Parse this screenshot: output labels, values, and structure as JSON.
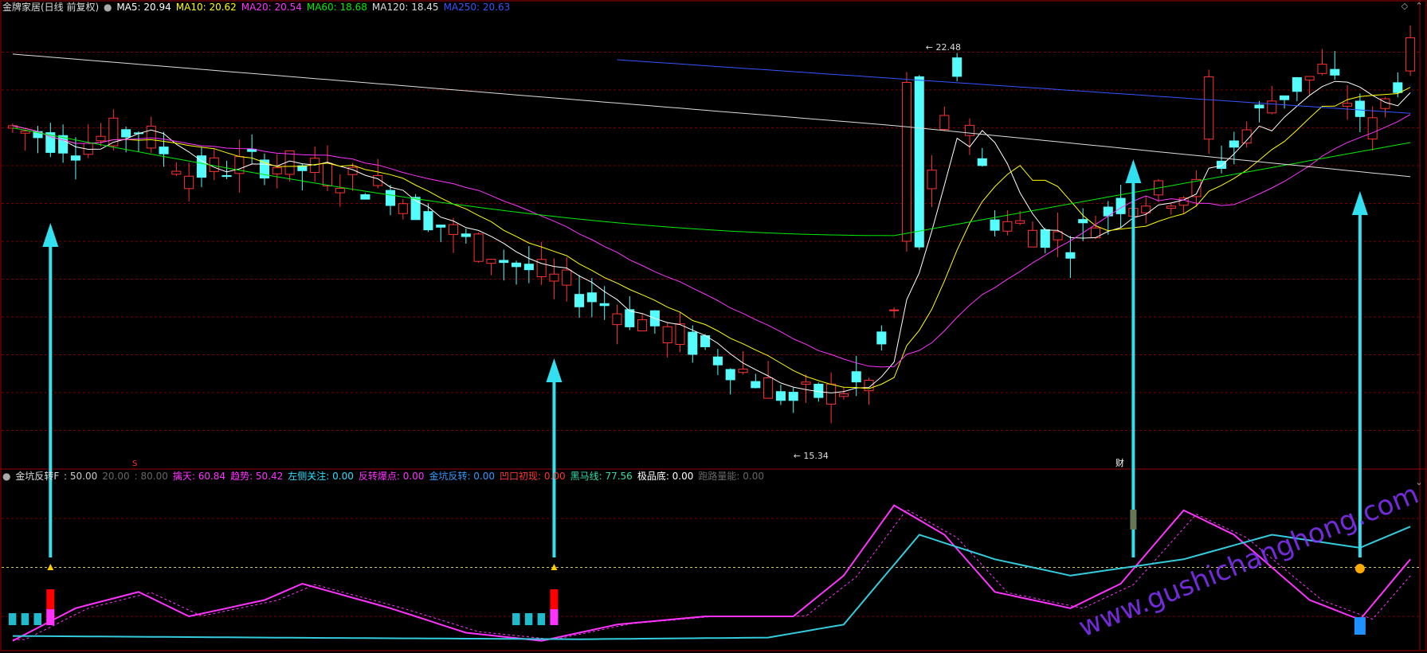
{
  "header": {
    "title": "金牌家居(日线 前复权)",
    "items": [
      {
        "label": "MA5: 20.94",
        "color": "#ffffff"
      },
      {
        "label": "MA10: 20.62",
        "color": "#ffff00"
      },
      {
        "label": "MA20: 20.54",
        "color": "#ff33ff"
      },
      {
        "label": "MA60: 18.68",
        "color": "#00ee00"
      },
      {
        "label": "MA120: 18.45",
        "color": "#dddddd"
      },
      {
        "label": "MA250: 20.63",
        "color": "#3355ff"
      }
    ]
  },
  "indicator_header": {
    "title": "金坑反转F",
    "items": [
      {
        "label": ": 50.00",
        "color": "#cccccc"
      },
      {
        "label": "20.00",
        "color": "#666666"
      },
      {
        "label": ": 80.00",
        "color": "#666666"
      },
      {
        "label": "擒天: 60.84",
        "color": "#ff33ff"
      },
      {
        "label": "趋势: 50.42",
        "color": "#ff33ff"
      },
      {
        "label": "左侧关注: 0.00",
        "color": "#33ddff"
      },
      {
        "label": "反转爆点: 0.00",
        "color": "#ff33ff"
      },
      {
        "label": "金坑反转: 0.00",
        "color": "#3399ff"
      },
      {
        "label": "凹口初现: 0.00",
        "color": "#ff3333"
      },
      {
        "label": "黑马线: 77.56",
        "color": "#33ddaa"
      },
      {
        "label": "极品底: 0.00",
        "color": "#ffffff"
      },
      {
        "label": "跑路量能: 0.00",
        "color": "#666666"
      }
    ]
  },
  "annotations": {
    "high_price": "22.48",
    "low_price": "15.34",
    "cai_label": "财",
    "s_marker": "S"
  },
  "watermark": "www.gushichanghong.com",
  "colors": {
    "up": "#ff3333",
    "down": "#54fcfc",
    "grid": "#7a0000",
    "arrow": "#33e0f0",
    "indicator_magenta": "#ff33ff",
    "indicator_cyan": "#33ccdd"
  },
  "chart_data": {
    "type": "candlestick",
    "series": [
      {
        "name": "MA5"
      },
      {
        "name": "MA10"
      },
      {
        "name": "MA20"
      },
      {
        "name": "MA60"
      },
      {
        "name": "MA120"
      },
      {
        "name": "MA250"
      }
    ],
    "y_range": [
      15.0,
      23.0
    ],
    "highest": 22.48,
    "lowest": 15.34,
    "indicator_levels": [
      20,
      50,
      80
    ],
    "indicator_range": [
      0,
      100
    ],
    "signal_bars": [
      3,
      43,
      89,
      107
    ]
  }
}
